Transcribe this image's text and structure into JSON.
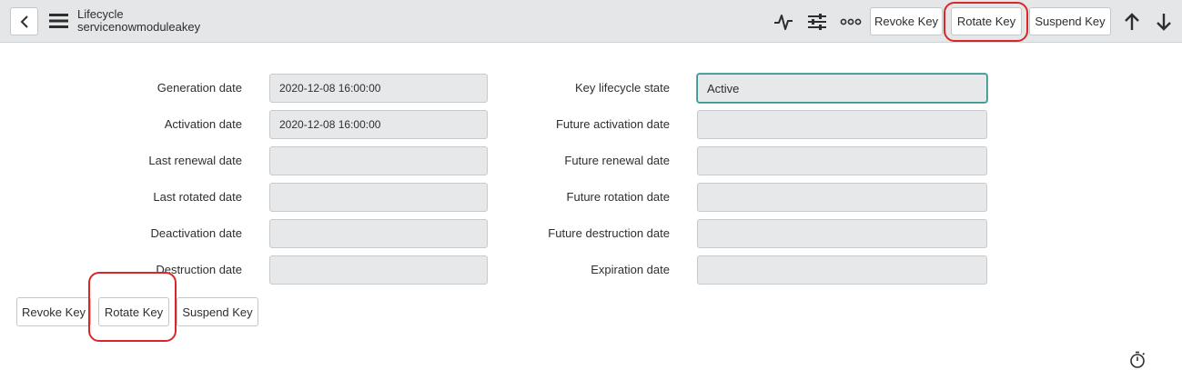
{
  "header": {
    "title": "Lifecycle",
    "subtitle": "servicenowmoduleakey",
    "icons": [
      "back-chevron-icon",
      "hamburger-menu-icon",
      "activity-icon",
      "sliders-icon",
      "more-icon",
      "arrow-up-icon",
      "arrow-down-icon"
    ],
    "buttons": {
      "revoke": "Revoke Key",
      "rotate": "Rotate Key",
      "suspend": "Suspend Key"
    }
  },
  "form": {
    "left": [
      {
        "label": "Generation date",
        "value": "2020-12-08 16:00:00"
      },
      {
        "label": "Activation date",
        "value": "2020-12-08 16:00:00"
      },
      {
        "label": "Last renewal date",
        "value": ""
      },
      {
        "label": "Last rotated date",
        "value": ""
      },
      {
        "label": "Deactivation date",
        "value": ""
      },
      {
        "label": "Destruction date",
        "value": ""
      }
    ],
    "right": [
      {
        "label": "Key lifecycle state",
        "value": "Active"
      },
      {
        "label": "Future activation date",
        "value": ""
      },
      {
        "label": "Future renewal date",
        "value": ""
      },
      {
        "label": "Future rotation date",
        "value": ""
      },
      {
        "label": "Future destruction date",
        "value": ""
      },
      {
        "label": "Expiration date",
        "value": ""
      }
    ]
  },
  "footer_buttons": {
    "revoke": "Revoke Key",
    "rotate": "Rotate Key",
    "suspend": "Suspend Key"
  },
  "colors": {
    "header_bg": "#e4e6e7",
    "field_bg": "#e6e8ea",
    "highlight": "#d9262b",
    "active_field_border": "#3a8f8a"
  }
}
